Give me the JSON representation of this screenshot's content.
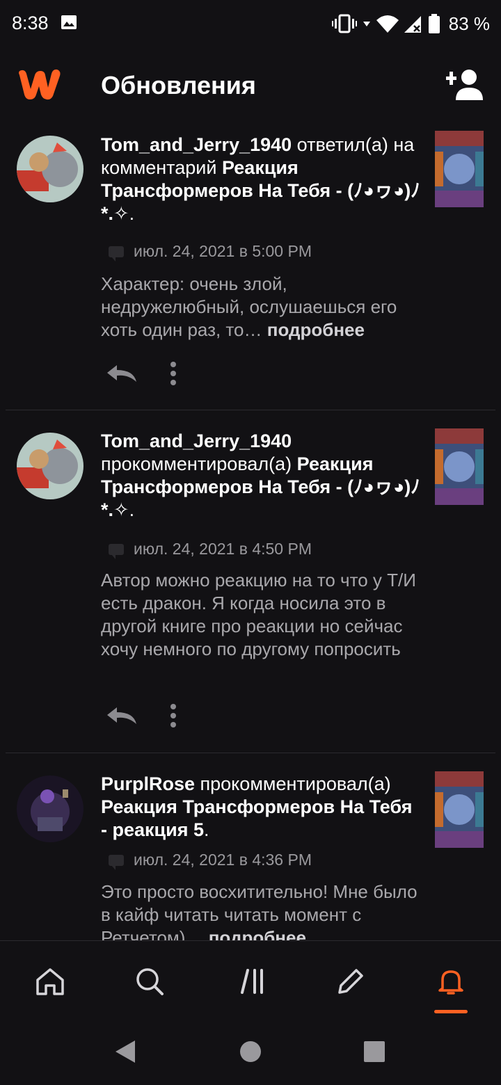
{
  "status_bar": {
    "time": "8:38",
    "battery": "83 %",
    "icons": [
      "gallery-icon",
      "vibrate-icon",
      "wifi-icon",
      "signal-icon",
      "battery-icon"
    ]
  },
  "header": {
    "title": "Обновления",
    "logo": "wattpad-logo",
    "action_icon": "add-user-icon"
  },
  "colors": {
    "accent": "#ff6122",
    "background": "#121114",
    "muted_text": "#a9a8ac"
  },
  "feed": [
    {
      "user": "Tom_and_Jerry_1940",
      "action": " ответил(а) на комментарий ",
      "story": "Реакция Трансформеров На Тебя - (ﾉ◕ヮ◕)ﾉ*.✧",
      "suffix": ".",
      "date": "июл. 24, 2021 в 5:00 PM",
      "text": "Характер: очень злой, недружелюбный, ослушаешься его хоть один раз, то…",
      "more": "подробнее"
    },
    {
      "user": "Tom_and_Jerry_1940",
      "action": " прокомментировал(а) ",
      "story": "Реакция Трансформеров На Тебя - (ﾉ◕ヮ◕)ﾉ*.✧",
      "suffix": ".",
      "date": "июл. 24, 2021 в 4:50 PM",
      "text": "Автор можно реакцию на то что у Т/И есть дракон. Я когда носила это в другой книге про реакции но сейчас хочу немного по другому попросить",
      "more": ""
    },
    {
      "user": "PurplRose",
      "action": " прокомментировал(а) ",
      "story": "Реакция Трансформеров На Тебя - реакция 5",
      "suffix": ".",
      "date": "июл. 24, 2021 в 4:36 PM",
      "text": "Это просто восхитительно! Мне было в кайф читать читать момент с Ретчетом)…",
      "more": "подробнее"
    }
  ],
  "bottom_nav": [
    "home-icon",
    "search-icon",
    "library-icon",
    "write-icon",
    "notifications-icon"
  ],
  "active_tab": "notifications-icon"
}
